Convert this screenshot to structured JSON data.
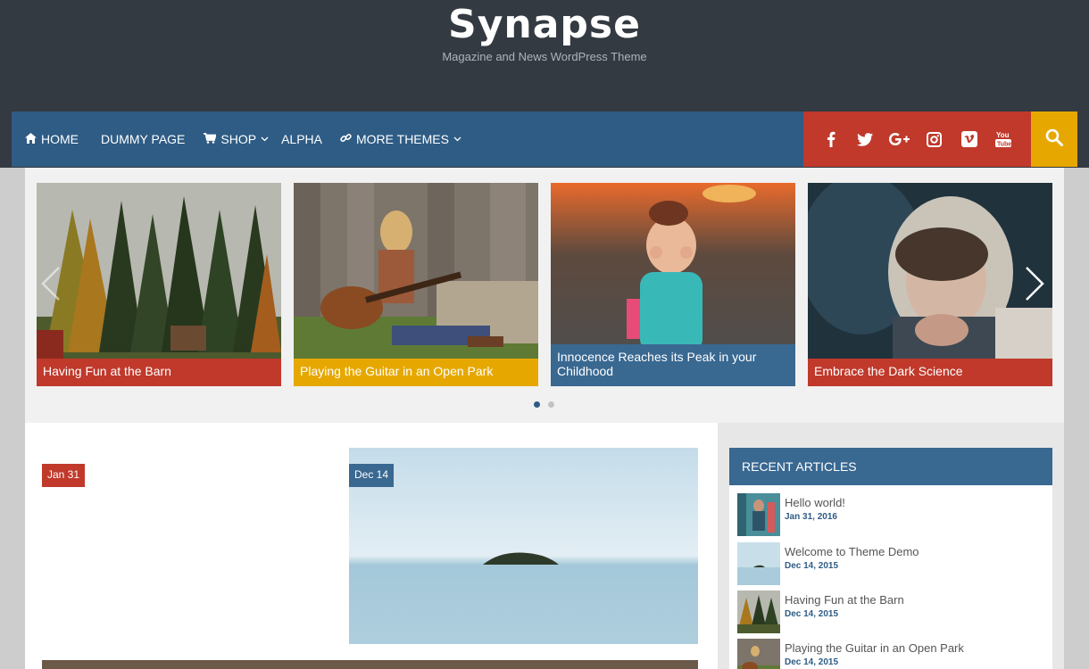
{
  "site": {
    "title": "Synapse",
    "tagline": "Magazine and News WordPress Theme"
  },
  "nav": {
    "items": [
      {
        "label": "HOME",
        "icon": "home-icon"
      },
      {
        "label": "DUMMY PAGE"
      },
      {
        "label": "SHOP",
        "icon": "cart-icon",
        "has_dropdown": true
      },
      {
        "label": "ALPHA"
      },
      {
        "label": "MORE THEMES",
        "icon": "link-icon",
        "has_dropdown": true
      }
    ],
    "social": [
      "facebook-icon",
      "twitter-icon",
      "google-plus-icon",
      "instagram-icon",
      "vimeo-icon",
      "youtube-icon"
    ],
    "colors": {
      "nav": "#2e5c85",
      "social": "#c0392b",
      "search": "#e6a800"
    }
  },
  "carousel": {
    "slides": [
      {
        "caption": "Having Fun at the Barn",
        "color": "#c0392b"
      },
      {
        "caption": "Playing the Guitar in an Open Park",
        "color": "#e6a800"
      },
      {
        "caption": "Innocence Reaches its Peak in your Childhood",
        "color": "#396891"
      },
      {
        "caption": "Embrace the Dark Science",
        "color": "#c0392b"
      }
    ],
    "active_dot": 0
  },
  "posts": [
    {
      "date": "Jan 31",
      "color": "#c0392b"
    },
    {
      "date": "Dec 14",
      "color": "#396891"
    }
  ],
  "sidebar": {
    "widget_title": "RECENT ARTICLES",
    "articles": [
      {
        "title": "Hello world!",
        "date": "Jan 31, 2016"
      },
      {
        "title": "Welcome to Theme Demo",
        "date": "Dec 14, 2015"
      },
      {
        "title": "Having Fun at the Barn",
        "date": "Dec 14, 2015"
      },
      {
        "title": "Playing the Guitar in an Open Park",
        "date": "Dec 14, 2015"
      }
    ]
  }
}
